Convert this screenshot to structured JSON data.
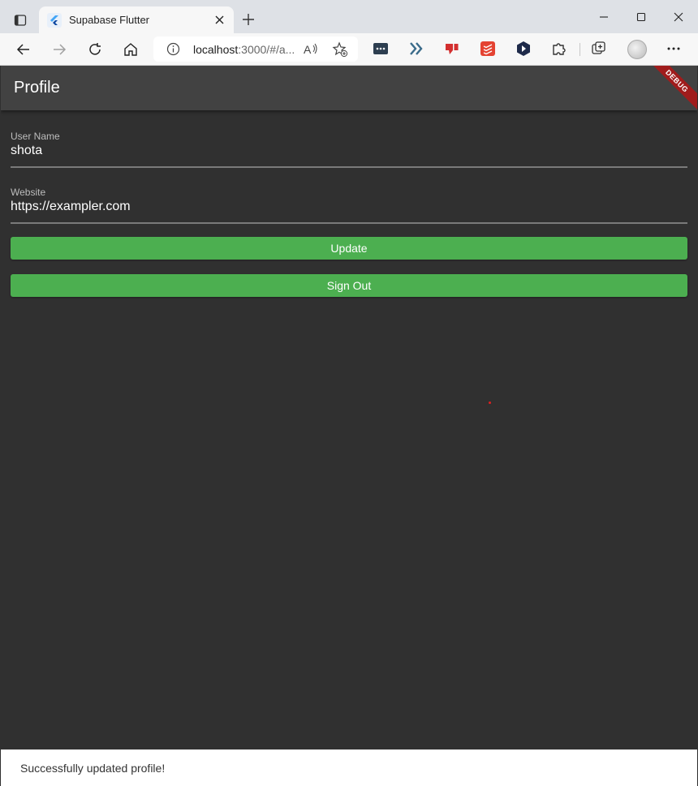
{
  "browser": {
    "tab_title": "Supabase Flutter",
    "url_host": "localhost",
    "url_path": ":3000/#/a...",
    "icons": {
      "tab_actions": "tab-actions-icon",
      "favicon": "flutter-icon",
      "close": "close-icon",
      "new_tab": "plus-icon",
      "back": "back-arrow-icon",
      "forward": "forward-arrow-icon",
      "refresh": "refresh-icon",
      "home": "home-icon",
      "site_info": "info-icon",
      "read_aloud": "read-aloud-icon",
      "favorites": "add-favorite-icon",
      "extensions": "puzzle-icon",
      "collections": "collections-icon",
      "more": "more-icon"
    }
  },
  "app": {
    "appbar_title": "Profile",
    "debug_banner": "DEBUG",
    "username_label": "User Name",
    "username_value": "shota",
    "website_label": "Website",
    "website_value": "https://exampler.com",
    "update_button": "Update",
    "signout_button": "Sign Out",
    "snackbar_message": "Successfully updated profile!"
  },
  "colors": {
    "accent": "#4caf50",
    "background": "#303030",
    "appbar": "#424242",
    "debug_banner": "#a01c1c"
  }
}
